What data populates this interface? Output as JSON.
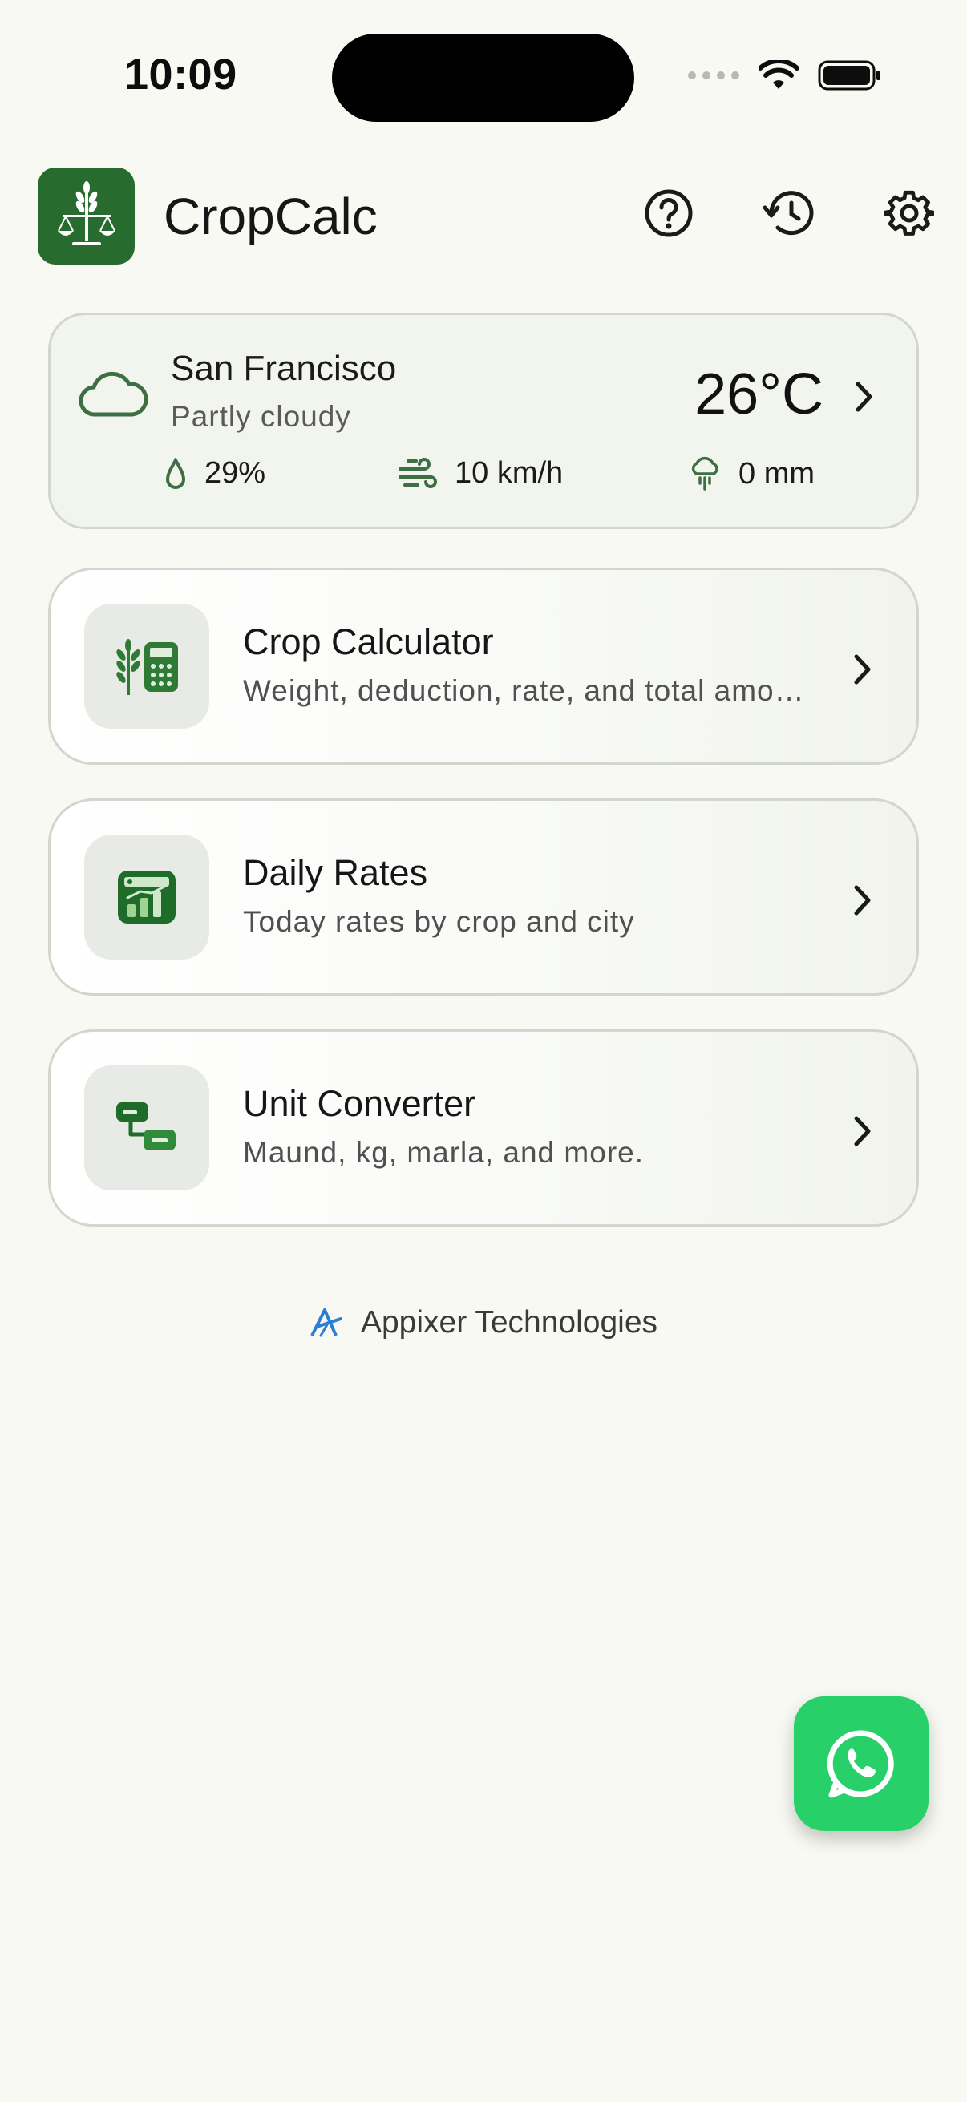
{
  "status_bar": {
    "time": "10:09"
  },
  "header": {
    "title": "CropCalc",
    "icons": [
      "scale-wheat-logo-icon",
      "help-icon",
      "history-icon",
      "gear-icon"
    ]
  },
  "weather": {
    "city": "San Francisco",
    "condition": "Partly cloudy",
    "temperature": "26°C",
    "humidity": "29%",
    "wind": "10 km/h",
    "precipitation": "0 mm"
  },
  "features": [
    {
      "title": "Crop Calculator",
      "subtitle": "Weight, deduction, rate, and total amount",
      "icon": "wheat-calculator-icon"
    },
    {
      "title": "Daily Rates",
      "subtitle": "Today rates by crop and city",
      "icon": "rates-chart-icon"
    },
    {
      "title": "Unit Converter",
      "subtitle": "Maund, kg, marla, and more.",
      "icon": "convert-icon"
    }
  ],
  "footer": {
    "brand": "Appixer Technologies"
  },
  "fab": {
    "icon": "whatsapp-icon"
  },
  "colors": {
    "primary": "#276b2e",
    "background": "#f7f9f2",
    "fab": "#28d06a",
    "brand_accent": "#2a7fd4"
  }
}
